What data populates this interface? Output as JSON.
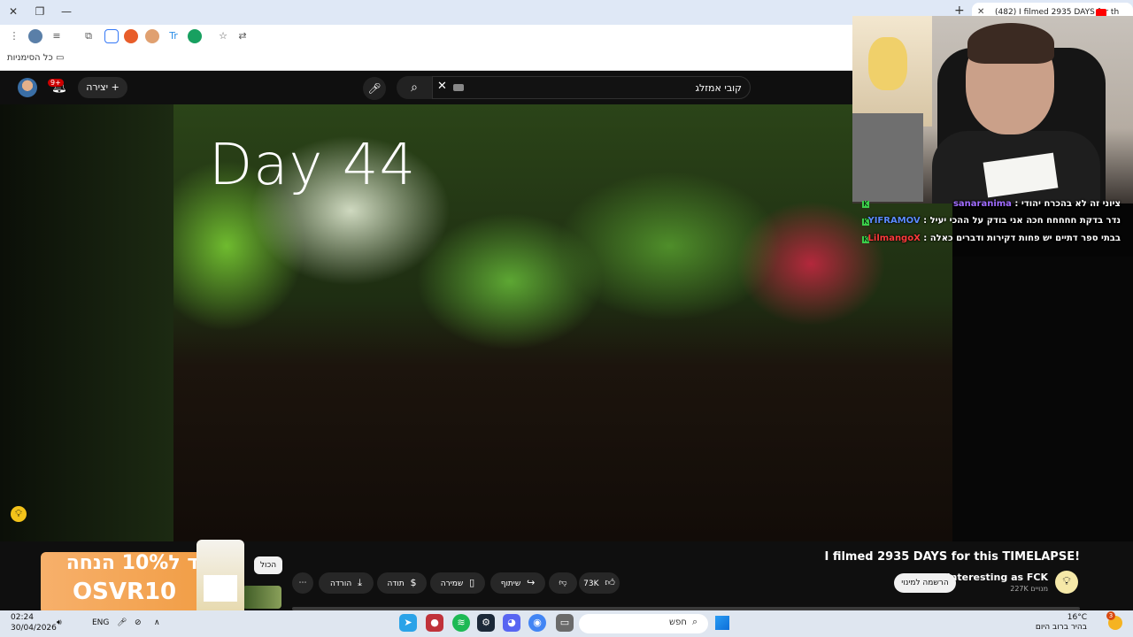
{
  "browser": {
    "tab_title": "(482) I filmed 2935 DAYS for th",
    "bookmarks_label": "כל הסימניות"
  },
  "youtube": {
    "search_value": "קובי אמזלג",
    "create_label": "יצירה",
    "notif_badge": "9+"
  },
  "video": {
    "overlay_text": "Day 44",
    "title": "I filmed 2935 DAYS for this TIMELAPSE!",
    "channel_name": "Interesting as FCK",
    "subscribers": "227K מנויים",
    "subscribe_label": "הרשמה למינוי",
    "likes": "73K",
    "share_label": "שיתוף",
    "save_label": "שמירה",
    "thanks_label": "תודה",
    "download_label": "הורדה",
    "all_chip": "הכול"
  },
  "chat": [
    {
      "user": "sanaranima",
      "user_color": "#a06cff",
      "message": "ציוני זה לא בהכרח יהודי"
    },
    {
      "user": "YIFRAMOV",
      "user_color": "#5b8cff",
      "message": "נדר בדקת חחחחח חכה אני בודק על ההכי יעיל"
    },
    {
      "user": "LilmangoX",
      "user_color": "#ff3b3b",
      "message": "בבתי ספר דתיים יש פחות דקירות ודברים כאלה"
    }
  ],
  "ad": {
    "line1": "קוד ל10% הנחה",
    "line2": "OSVR10"
  },
  "taskbar": {
    "time": "02:24",
    "date": "30/04/2026",
    "language": "ENG",
    "search_label": "חפש",
    "temperature": "16°C",
    "weather_desc": "בהיר ברוב היום",
    "notif_count": "3"
  }
}
